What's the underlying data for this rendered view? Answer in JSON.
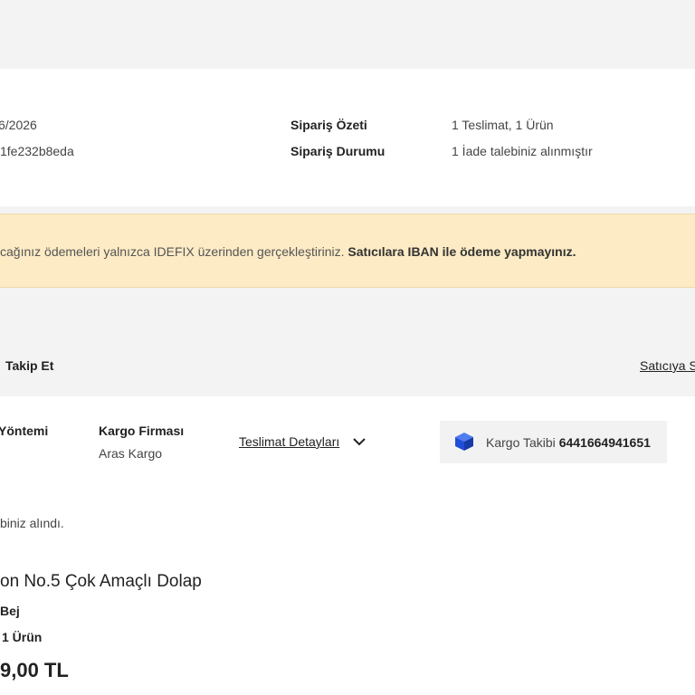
{
  "summary": {
    "date_partial": "6/2026",
    "order_no_partial": "1fe232b8eda",
    "order_summary_label": "Sipariş Özeti",
    "order_summary_value": "1 Teslimat, 1 Ürün",
    "order_status_label": "Sipariş Durumu",
    "order_status_value": "1 İade talebiniz alınmıştır"
  },
  "warning": {
    "text_normal": "cağınız ödemeleri yalnızca IDEFIX üzerinden gerçekleştiriniz. ",
    "text_bold": "Satıcılara IBAN ile ödeme yapmayınız."
  },
  "tracking": {
    "follow_label": "Takip Et",
    "seller_link": "Satıcıya S"
  },
  "delivery": {
    "method_label": "Yöntemi",
    "carrier_label": "Kargo Firması",
    "carrier_value": "Aras Kargo",
    "details_link": "Teslimat Detayları",
    "cargo_tracking_label": "Kargo Takibi",
    "cargo_tracking_number": "6441664941651",
    "return_note": "biniz alındı."
  },
  "product": {
    "title": "on No.5 Çok Amaçlı Dolap",
    "color": "Bej",
    "quantity": "1 Ürün",
    "price": "9,00 TL"
  },
  "colors": {
    "warning_bg": "#fdebc5",
    "cargo_icon": "#1f4fd8"
  }
}
